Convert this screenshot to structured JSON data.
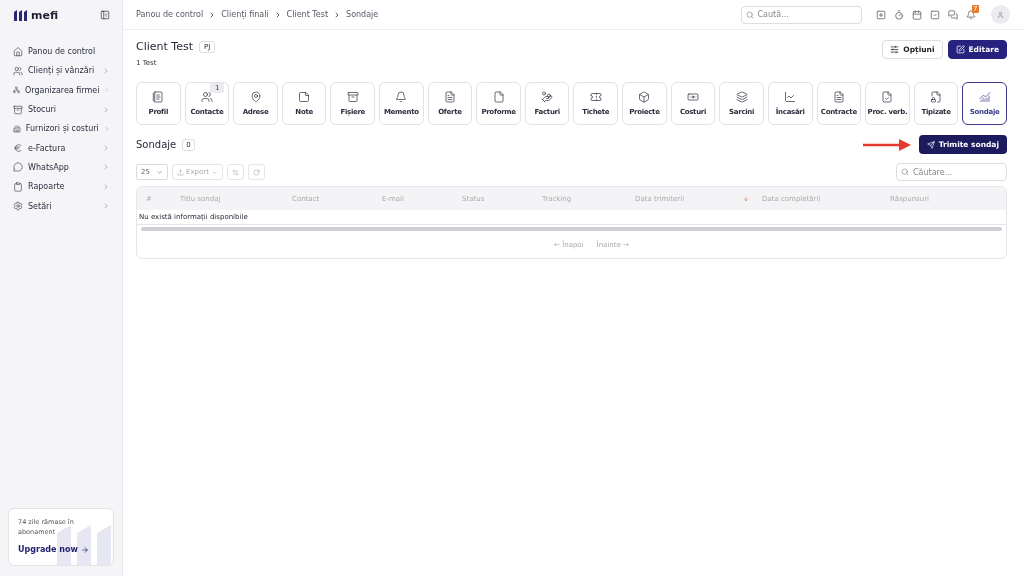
{
  "sidebar": {
    "logo": "mefi",
    "items": [
      {
        "kind": "home",
        "label": "Panou de control",
        "expandable": false
      },
      {
        "kind": "users",
        "label": "Clienți și vânzări",
        "expandable": true
      },
      {
        "kind": "network",
        "label": "Organizarea firmei",
        "expandable": true
      },
      {
        "kind": "archive",
        "label": "Stocuri",
        "expandable": true
      },
      {
        "kind": "building",
        "label": "Furnizori și costuri",
        "expandable": true
      },
      {
        "kind": "euro",
        "label": "e-Factura",
        "expandable": true
      },
      {
        "kind": "chat",
        "label": "WhatsApp",
        "expandable": true
      },
      {
        "kind": "clipboard",
        "label": "Rapoarte",
        "expandable": true
      },
      {
        "kind": "settings",
        "label": "Setări",
        "expandable": true
      }
    ],
    "upgrade": {
      "text": "74 zile rămase în abonament",
      "link": "Upgrade now"
    }
  },
  "topbar": {
    "breadcrumbs": [
      "Panou de control",
      "Clienți finali",
      "Client Test",
      "Sondaje"
    ],
    "search": {
      "placeholder": "Caută..."
    },
    "notification_count": "7"
  },
  "client": {
    "name": "Client Test",
    "tag": "PJ",
    "subtitle": "1 Test",
    "buttons": [
      {
        "label": "Opțiuni",
        "kind": "outline"
      },
      {
        "label": "Editare",
        "kind": "primary"
      }
    ]
  },
  "tiles": [
    {
      "kind": "profile",
      "label": "Profil",
      "selected": false
    },
    {
      "kind": "users",
      "label": "Contacte",
      "selected": false,
      "count": "1"
    },
    {
      "kind": "pin",
      "label": "Adrese",
      "selected": false
    },
    {
      "kind": "note",
      "label": "Note",
      "selected": false
    },
    {
      "kind": "archive",
      "label": "Fișiere",
      "selected": false
    },
    {
      "kind": "bell",
      "label": "Memento",
      "selected": false
    },
    {
      "kind": "filetext",
      "label": "Oferte",
      "selected": false
    },
    {
      "kind": "file",
      "label": "Proforme",
      "selected": false
    },
    {
      "kind": "coins",
      "label": "Facturi",
      "selected": false
    },
    {
      "kind": "ticket",
      "label": "Tichete",
      "selected": false
    },
    {
      "kind": "box",
      "label": "Proiecte",
      "selected": false
    },
    {
      "kind": "banknote",
      "label": "Costuri",
      "selected": false
    },
    {
      "kind": "layers",
      "label": "Sarcini",
      "selected": false
    },
    {
      "kind": "chart",
      "label": "Încasări",
      "selected": false
    },
    {
      "kind": "filetext",
      "label": "Contracte",
      "selected": false
    },
    {
      "kind": "filecheck",
      "label": "Proc. verb.",
      "selected": false
    },
    {
      "kind": "filelock",
      "label": "Tipizate",
      "selected": false
    },
    {
      "kind": "survey",
      "label": "Sondaje",
      "selected": true
    }
  ],
  "section": {
    "title": "Sondaje",
    "count": "0",
    "send_button": "Trimite sondaj"
  },
  "toolbar": {
    "page_size": "25",
    "export": "Export",
    "search": {
      "placeholder": "Căutare..."
    }
  },
  "table": {
    "columns": [
      {
        "label": "#",
        "sorted": false
      },
      {
        "label": "Titlu sondaj",
        "sorted": false
      },
      {
        "label": "Contact",
        "sorted": false
      },
      {
        "label": "E-mail",
        "sorted": false
      },
      {
        "label": "Status",
        "sorted": false
      },
      {
        "label": "Tracking",
        "sorted": false
      },
      {
        "label": "Data trimiterii",
        "sorted": true
      },
      {
        "label": "Data completării",
        "sorted": false
      },
      {
        "label": "Răspunsuri",
        "sorted": false
      }
    ],
    "empty": "Nu există informații disponibile"
  },
  "pagination": {
    "prev": "← Înapoi",
    "next": "Înainte →"
  }
}
